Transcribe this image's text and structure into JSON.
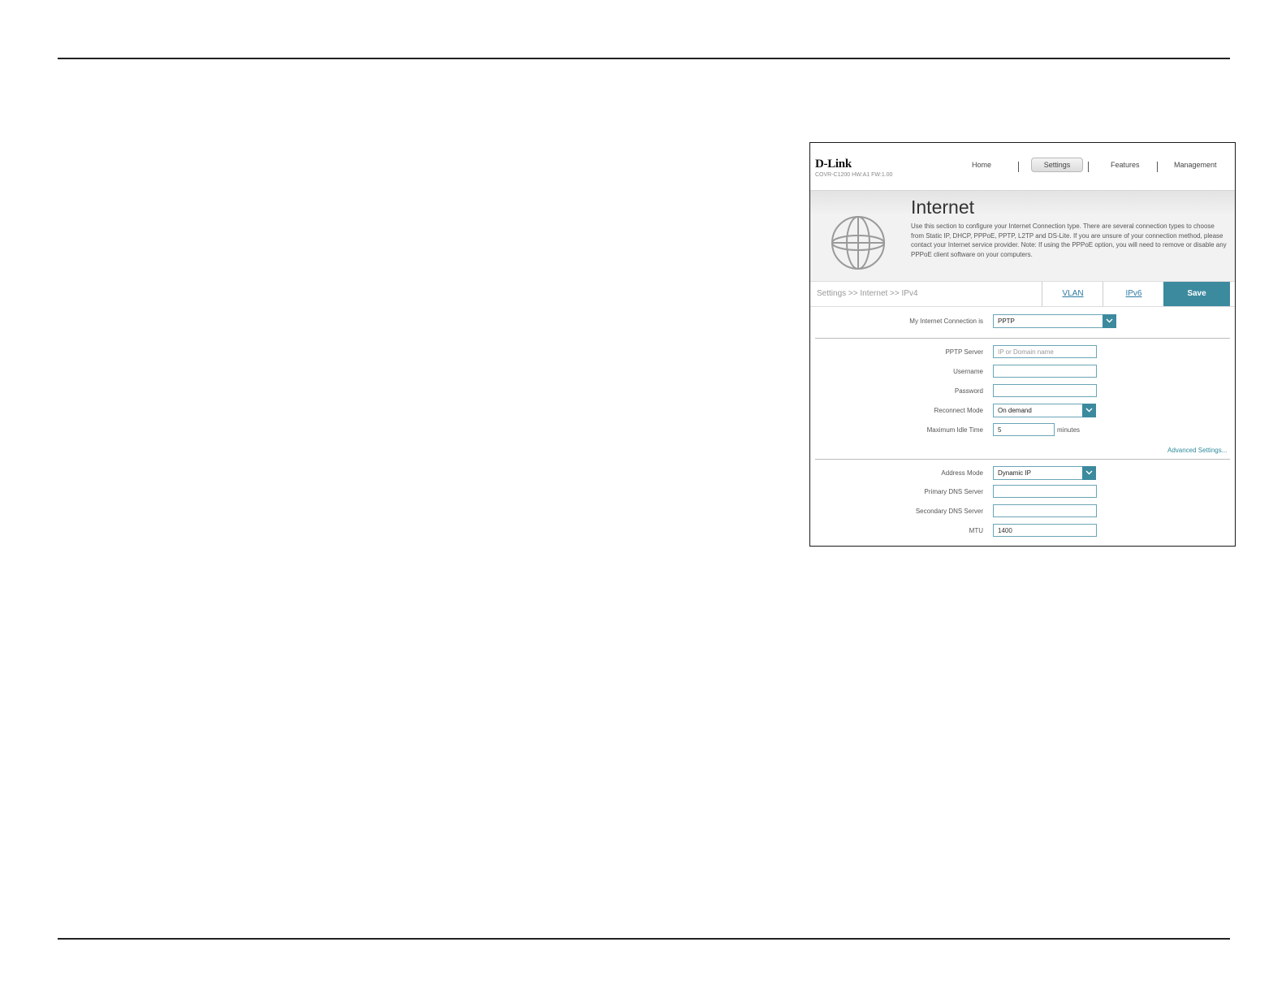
{
  "header": {
    "logo": "D-Link",
    "model": "COVR-C1200 HW:A1 FW:1.00",
    "nav": [
      "Home",
      "Settings",
      "Features",
      "Management"
    ]
  },
  "banner": {
    "title": "Internet",
    "description": "Use this section to configure your Internet Connection type. There are several connection types to choose from Static IP, DHCP, PPPoE, PPTP, L2TP and DS-Lite. If you are unsure of your connection method, please contact your Internet service provider. Note: If using the PPPoE option, you will need to remove or disable any PPPoE client software on your computers."
  },
  "toolbar": {
    "breadcrumb": "Settings >> Internet >> IPv4",
    "vlan": "VLAN",
    "ipv6": "IPv6",
    "save": "Save"
  },
  "form": {
    "connection_label": "My Internet Connection is",
    "connection_value": "PPTP",
    "pptp_server_label": "PPTP Server",
    "pptp_server_placeholder": "IP or Domain name",
    "username_label": "Username",
    "username_value": "",
    "password_label": "Password",
    "password_value": "",
    "reconnect_label": "Reconnect Mode",
    "reconnect_value": "On demand",
    "idle_label": "Maximum Idle Time",
    "idle_value": "5",
    "idle_unit": "minutes",
    "advanced_link": "Advanced Settings...",
    "address_mode_label": "Address Mode",
    "address_mode_value": "Dynamic IP",
    "primary_dns_label": "Primary DNS Server",
    "primary_dns_value": "",
    "secondary_dns_label": "Secondary DNS Server",
    "secondary_dns_value": "",
    "mtu_label": "MTU",
    "mtu_value": "1400"
  },
  "colors": {
    "accent": "#3c8a9e",
    "link": "#2e7ba3",
    "input_border": "#6aa5b5"
  }
}
